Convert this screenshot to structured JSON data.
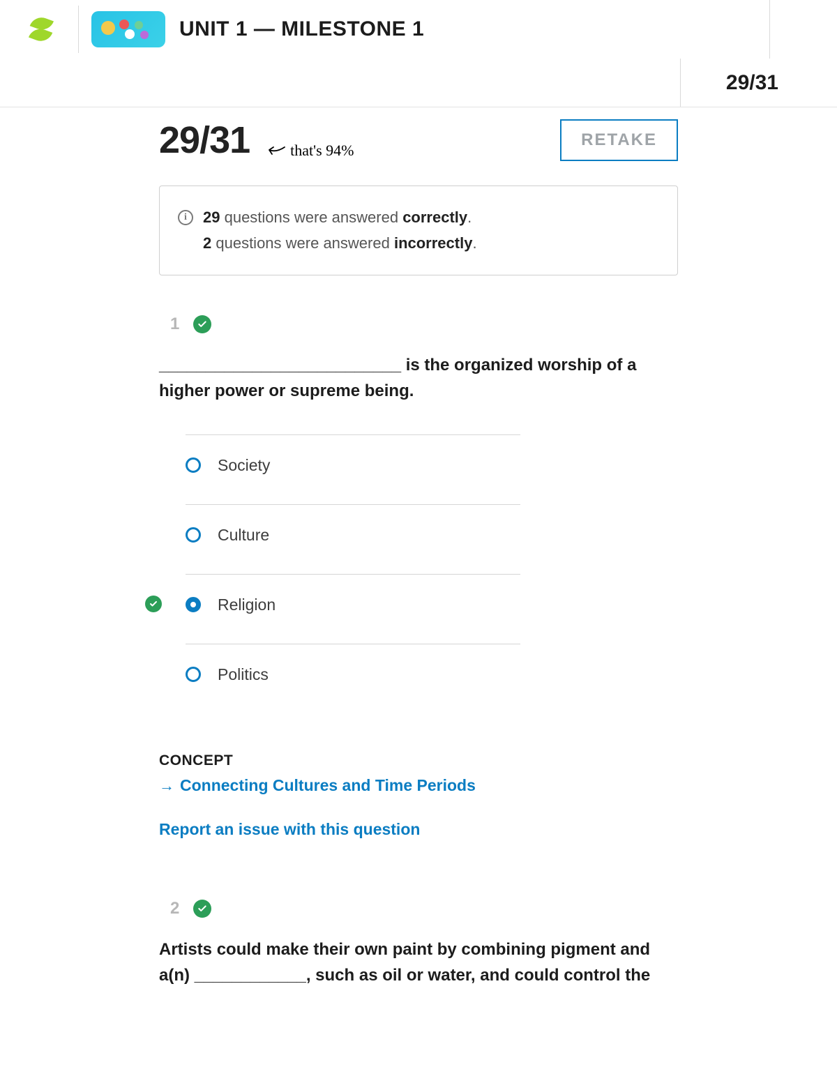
{
  "header": {
    "unit_title": "UNIT 1 — MILESTONE 1"
  },
  "score": {
    "small": "29/31",
    "big": "29/31",
    "hand_note": "that's 94%",
    "retake_label": "RETAKE"
  },
  "summary": {
    "correct_count": "29",
    "correct_text": " questions were answered ",
    "correct_word": "correctly",
    "incorrect_count": "2",
    "incorrect_text": " questions were answered ",
    "incorrect_word": "incorrectly"
  },
  "q1": {
    "number": "1",
    "text": "__________________________ is the organized worship of a higher power or supreme being.",
    "choices": [
      "Society",
      "Culture",
      "Religion",
      "Politics"
    ],
    "selected_index": 2,
    "correct_index": 2,
    "concept_label": "CONCEPT",
    "concept_link": "Connecting Cultures and Time Periods",
    "report_label": "Report an issue with this question"
  },
  "q2": {
    "number": "2",
    "text": "Artists could make their own paint by combining pigment and a(n) ____________, such as oil or water, and could control the"
  }
}
